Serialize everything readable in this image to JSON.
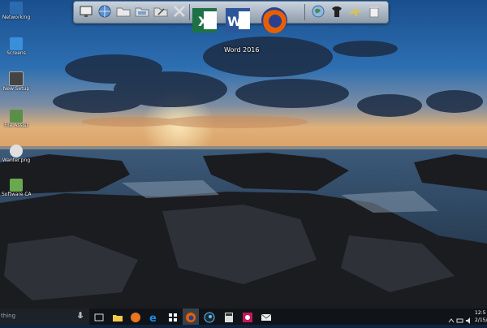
{
  "desktop": {
    "icons": [
      {
        "label": "Networking",
        "color": "#2b6cb0"
      },
      {
        "label": "Screens",
        "color": "#3a8fd8"
      },
      {
        "label": "New Setup",
        "color": "#444"
      },
      {
        "label": "File Assist",
        "color": "#5a8f4a"
      },
      {
        "label": "Wanter.png",
        "color": "#e0e0e0"
      },
      {
        "label": "Software CAPE.zip",
        "color": "#6aa84f"
      }
    ]
  },
  "dock": {
    "icons": [
      "display-icon",
      "globe-icon",
      "folder-icon",
      "folder-open-icon",
      "folder-edit-icon",
      "tools-icon",
      "excel-icon",
      "word-icon",
      "firefox-icon",
      "earth-icon",
      "shirt-icon",
      "plane-icon",
      "recycle-bin-icon"
    ],
    "tooltip": "Word 2016"
  },
  "taskbar": {
    "search_placeholder": "thing",
    "pinned": [
      "task-view-icon",
      "file-explorer-icon",
      "media-icon",
      "edge-icon",
      "store-icon",
      "firefox-icon",
      "steam-icon",
      "calculator-icon",
      "photo-icon",
      "mail-icon"
    ],
    "clock_time": "12:5",
    "clock_date": "2/15/"
  },
  "colors": {
    "excel": "#1e7145",
    "word": "#2b579a",
    "firefox": "#e66000",
    "taskbar": "#101418"
  }
}
